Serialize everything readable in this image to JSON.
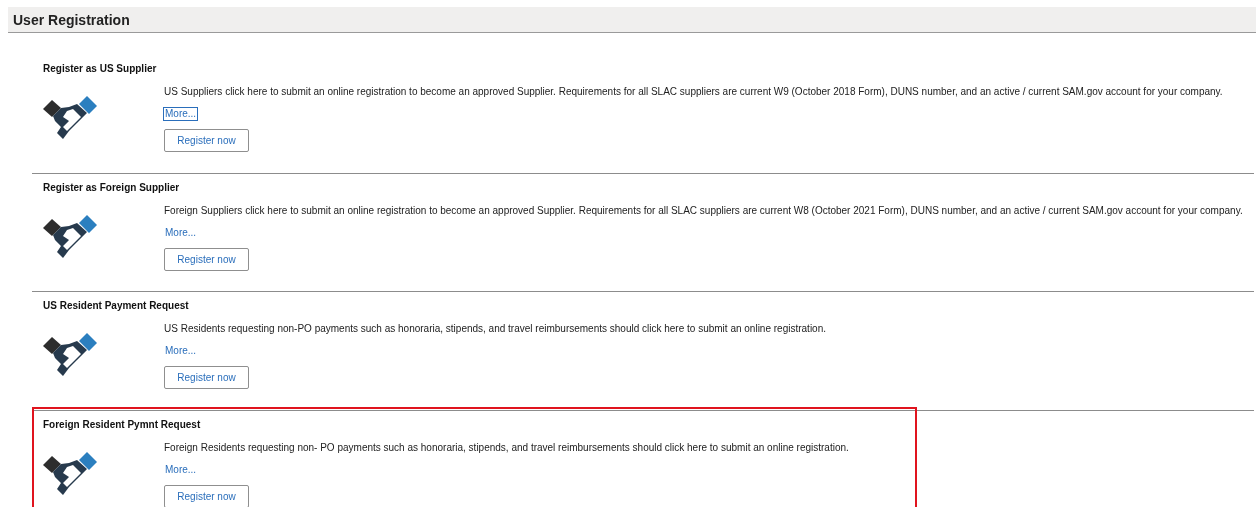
{
  "page_title": "User Registration",
  "sections": [
    {
      "title": "Register as US Supplier",
      "description": "US Suppliers click here to submit an online registration to become an approved Supplier. Requirements for all SLAC suppliers are current W9 (October 2018 Form), DUNS number, and an active / current SAM.gov account for your company.",
      "more_link": "More...",
      "more_focused": true,
      "button": "Register now",
      "highlighted": false
    },
    {
      "title": "Register as Foreign Supplier",
      "description": "Foreign Suppliers click here to submit an online registration to become an approved Supplier. Requirements for all SLAC suppliers are current W8 (October 2021 Form), DUNS number, and an active / current SAM.gov account for your company.",
      "more_link": "More...",
      "more_focused": false,
      "button": "Register now",
      "highlighted": false
    },
    {
      "title": "US Resident Payment Request",
      "description": "US Residents requesting non-PO payments such as honoraria, stipends, and travel reimbursements should click here to submit an online registration.",
      "more_link": "More...",
      "more_focused": false,
      "button": "Register now",
      "highlighted": false
    },
    {
      "title": "Foreign Resident Pymnt Request",
      "description": "Foreign Residents requesting non- PO payments such as honoraria, stipends, and travel reimbursements should click here to submit an online registration.",
      "more_link": "More...",
      "more_focused": false,
      "button": "Register now",
      "highlighted": true
    }
  ]
}
